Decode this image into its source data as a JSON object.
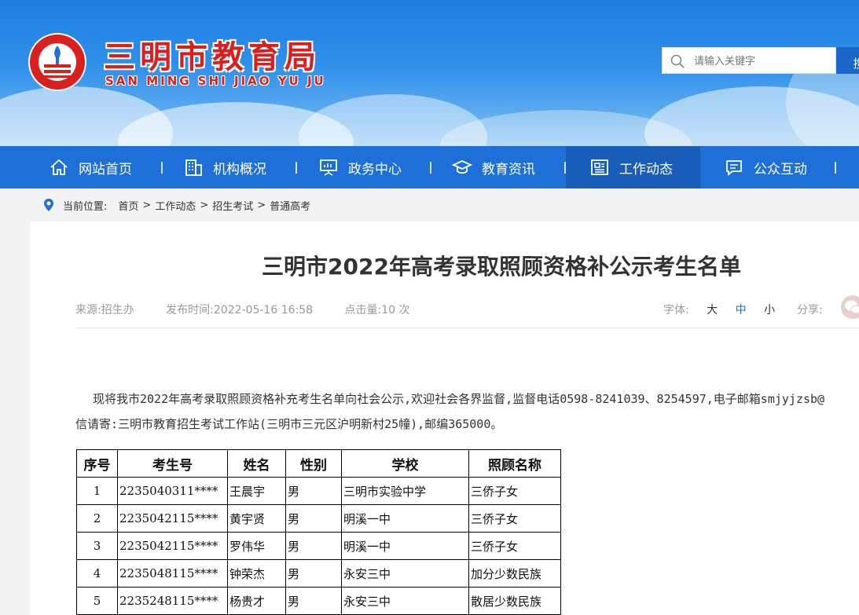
{
  "header": {
    "title": "三明市教育局",
    "subtitle": "SAN MING SHI JIAO YU JU",
    "search_placeholder": "请输入关键字",
    "search_button": "搜"
  },
  "nav": {
    "items": [
      {
        "label": "网站首页",
        "icon": "home-icon"
      },
      {
        "label": "机构概况",
        "icon": "building-icon"
      },
      {
        "label": "政务中心",
        "icon": "presentation-icon"
      },
      {
        "label": "教育资讯",
        "icon": "graduation-cap-icon"
      },
      {
        "label": "工作动态",
        "icon": "newspaper-icon",
        "active": true
      },
      {
        "label": "公众互动",
        "icon": "chat-icon"
      }
    ]
  },
  "breadcrumb": {
    "prefix": "当前位置:",
    "items": [
      "首页",
      "工作动态",
      "招生考试",
      "普通高考"
    ],
    "separator": ">"
  },
  "article": {
    "title": "三明市2022年高考录取照顾资格补公示考生名单",
    "source": "来源:招生办",
    "published": "发布时间:2022-05-16 16:58",
    "views": "点击量:10 次",
    "font_label": "字体:",
    "font_options": [
      "大",
      "中",
      "小"
    ],
    "share_label": "分享:",
    "paragraph_line1": "现将我市2022年高考录取照顾资格补充考生名单向社会公示,欢迎社会各界监督,监督电话0598-8241039、8254597,电子邮箱smjyjzsb@",
    "paragraph_line2": "信请寄:三明市教育招生考试工作站(三明市三元区沪明新村25幢),邮编365000。"
  },
  "table": {
    "headers": [
      "序号",
      "考生号",
      "姓名",
      "性别",
      "学校",
      "照顾名称"
    ],
    "rows": [
      [
        "1",
        "2235040311****",
        "王晨宇",
        "男",
        "三明市实验中学",
        "三侨子女"
      ],
      [
        "2",
        "2235042115****",
        "黄宇贤",
        "男",
        "明溪一中",
        "三侨子女"
      ],
      [
        "3",
        "2235042115****",
        "罗伟华",
        "男",
        "明溪一中",
        "三侨子女"
      ],
      [
        "4",
        "2235048115****",
        "钟荣杰",
        "男",
        "永安三中",
        "加分少数民族"
      ],
      [
        "5",
        "2235248115****",
        "杨贵才",
        "男",
        "永安三中",
        "散居少数民族"
      ]
    ]
  },
  "colors": {
    "nav_bg": "#1e6fd8",
    "nav_active": "#1a5db8",
    "title_red": "#d8201e"
  }
}
